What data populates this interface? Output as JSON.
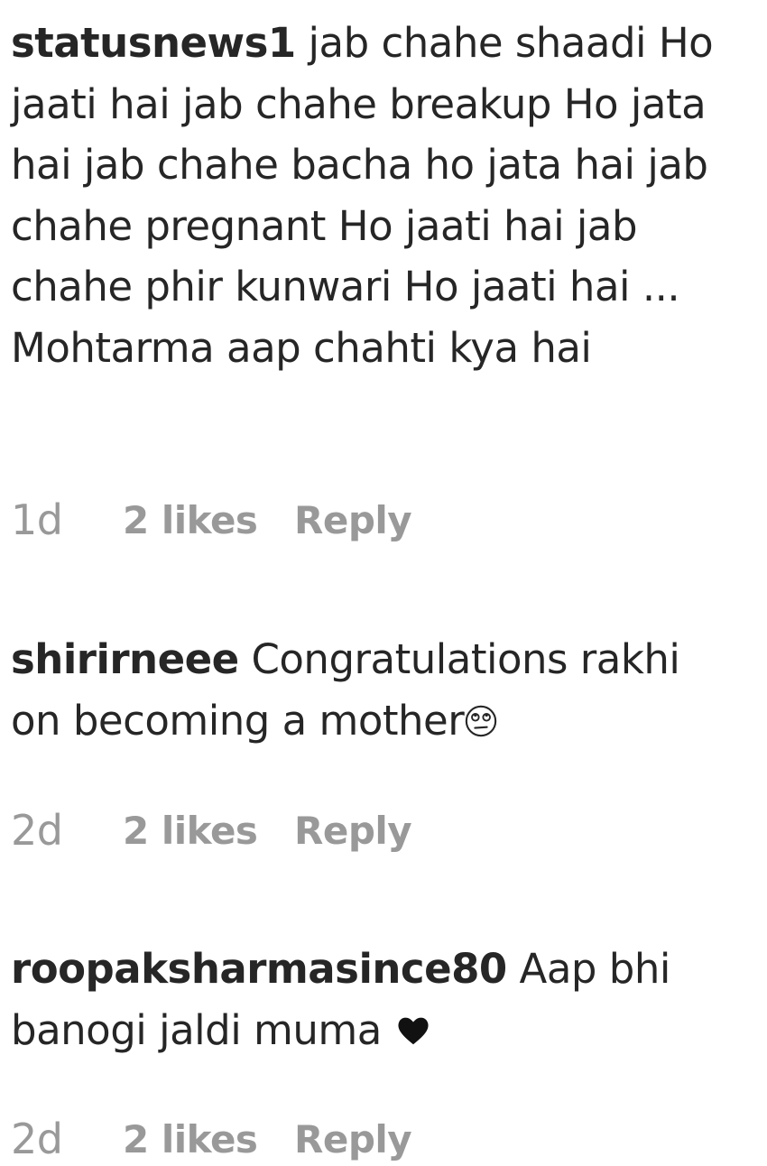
{
  "comments": [
    {
      "username": "statusnews1",
      "text": "jab chahe shaadi Ho jaati hai jab chahe breakup Ho jata hai jab chahe bacha ho jata hai jab chahe pregnant Ho jaati hai jab chahe phir kunwari Ho jaati hai ... Mohtarma aap chahti kya hai",
      "time": "1d",
      "likes": "2 likes",
      "reply_label": "Reply"
    },
    {
      "username": "shirirneee",
      "text": "Congratulations rakhi on becoming a mother",
      "emoji": "rolling-eyes-face",
      "time": "2d",
      "likes": "2 likes",
      "reply_label": "Reply"
    },
    {
      "username": "roopaksharmasince80",
      "text": "Aap bhi banogi jaldi muma",
      "emoji": "black-heart",
      "time": "2d",
      "likes": "2 likes",
      "reply_label": "Reply"
    }
  ]
}
